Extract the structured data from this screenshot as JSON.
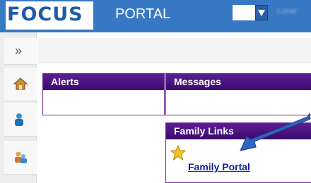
{
  "header": {
    "logo_text": "FOCUS",
    "portal_label": "PORTAL",
    "user_name": "Lunar"
  },
  "sidebar": {
    "expand_label": "»",
    "items": [
      {
        "icon": "home-icon"
      },
      {
        "icon": "student-icon"
      },
      {
        "icon": "family-icon"
      }
    ]
  },
  "panels": {
    "alerts_title": "Alerts",
    "messages_title": "Messages",
    "family_links_title": "Family Links"
  },
  "family_links": {
    "link_label": "Family Portal",
    "link_icon": "star-icon"
  },
  "colors": {
    "header_blue": "#3778c4",
    "panel_purple": "#4a1580",
    "link_blue": "#0a1fa0",
    "arrow_blue": "#3064c0"
  }
}
